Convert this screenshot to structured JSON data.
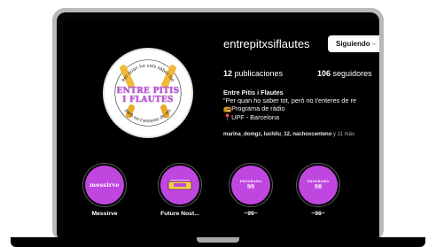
{
  "profile": {
    "username": "entrepitxsiflautes",
    "follow_label": "Siguiendo",
    "posts_count": "12",
    "posts_label": "publicaciones",
    "followers_count": "106",
    "followers_label": "seguidores",
    "display_name": "Entre Pitis i Flautes",
    "bio_line1": "\"Per quan ho saber tot, però no t'enteres de re",
    "bio_line2": "Programa de ràdio",
    "bio_line3": "UPF - Barcelona",
    "followed_by_names": "marina_domgz, luchilu_12, nachoxcenteno",
    "followed_by_more": " y 11 más"
  },
  "logo": {
    "main_text_line1": "ENTRE PITIS",
    "main_text_line2": "I FLAUTES",
    "top_arc": "Per quan ho vols saber tot",
    "bottom_arc": "però no t'enteres de res",
    "accent_color": "#c64fe4"
  },
  "highlights": [
    {
      "label": "Messirve",
      "cover_text": "messirve"
    },
    {
      "label": "Future Nost...",
      "cover_text": ""
    },
    {
      "label": "~99~",
      "cover_small": "PROGRAMA",
      "cover_num": "99"
    },
    {
      "label": "~98~",
      "cover_small": "PROGRAMA",
      "cover_num": "98"
    }
  ],
  "icons": [
    "chevron-down-icon",
    "radio-icon",
    "location-pin-icon"
  ],
  "colors": {
    "highlight_purple": "#c046e0",
    "screen_bg": "#000000",
    "laptop_frame": "#b9b9b9"
  }
}
